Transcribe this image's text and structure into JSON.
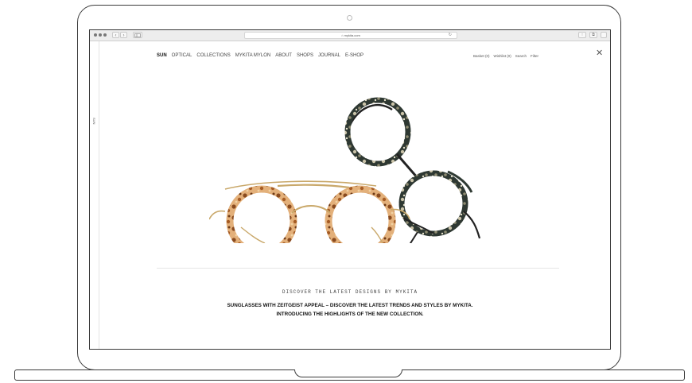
{
  "browser": {
    "url": "⌂ mykita.com",
    "back_label": "‹",
    "forward_label": "›",
    "sidebar_toggle_icon": "sidebar-icon",
    "reload_icon": "↻",
    "share_icon": "↑",
    "tabs_icon": "⧉"
  },
  "rail": {
    "label": "SUN"
  },
  "nav": {
    "items": [
      "SUN",
      "OPTICAL",
      "COLLECTIONS",
      "MYKITA MYLON",
      "ABOUT",
      "SHOPS",
      "JOURNAL",
      "E-SHOP"
    ]
  },
  "util": {
    "basket": "Basket (0)",
    "wishlist": "Wishlist (0)",
    "search": "Search",
    "filter": "Filter",
    "close": "✕"
  },
  "hero": {
    "kicker": "DISCOVER THE LATEST DESIGNS BY MYKITA",
    "headline_1": "SUNGLASSES WITH ZEITGEIST APPEAL – DISCOVER THE LATEST TRENDS AND STYLES BY MYKITA.",
    "headline_2": "INTRODUCING THE HIGHLIGHTS OF THE NEW COLLECTION."
  },
  "colors": {
    "tortoise_light": "#d9a066",
    "tortoise_dark": "#2f3a33",
    "gold_metal": "#c9a86a",
    "black_metal": "#222222"
  }
}
